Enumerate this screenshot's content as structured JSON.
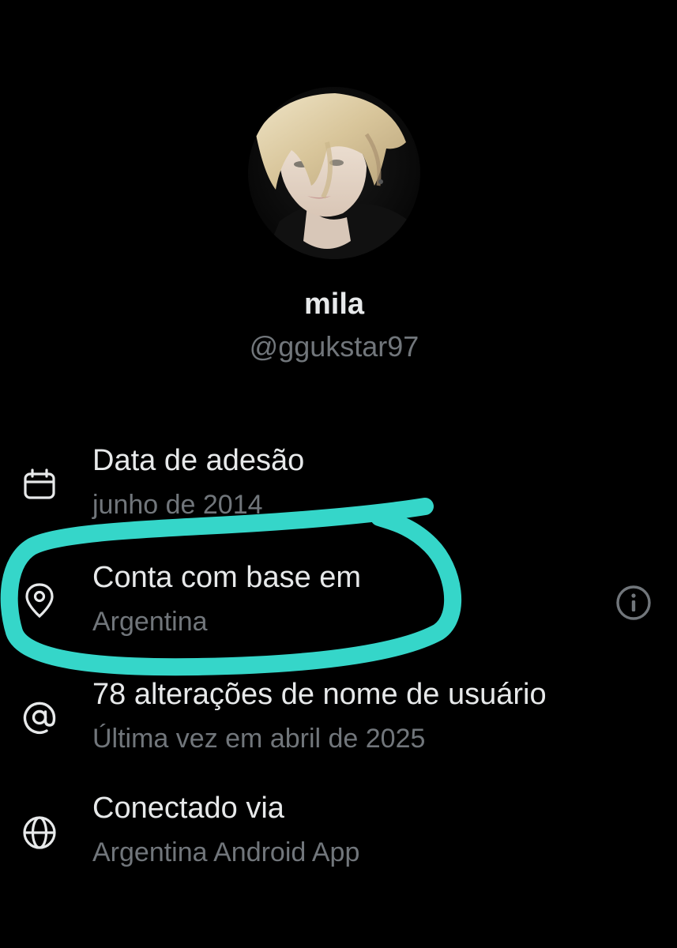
{
  "profile": {
    "display_name": "mila",
    "handle": "@ggukstar97"
  },
  "about": {
    "items": [
      {
        "icon": "calendar-icon",
        "label": "Data de adesão",
        "value": "junho de 2014"
      },
      {
        "icon": "location-pin-icon",
        "label": "Conta com base em",
        "value": "Argentina"
      },
      {
        "icon": "at-sign-icon",
        "label": "78 alterações de nome de usuário",
        "value": "Última vez em abril de 2025"
      },
      {
        "icon": "globe-icon",
        "label": "Conectado via",
        "value": "Argentina Android App"
      }
    ]
  },
  "colors": {
    "background": "#000000",
    "primary_text": "#e7e9ea",
    "secondary_text": "#71767b",
    "highlight_marker": "#35d6c9"
  }
}
